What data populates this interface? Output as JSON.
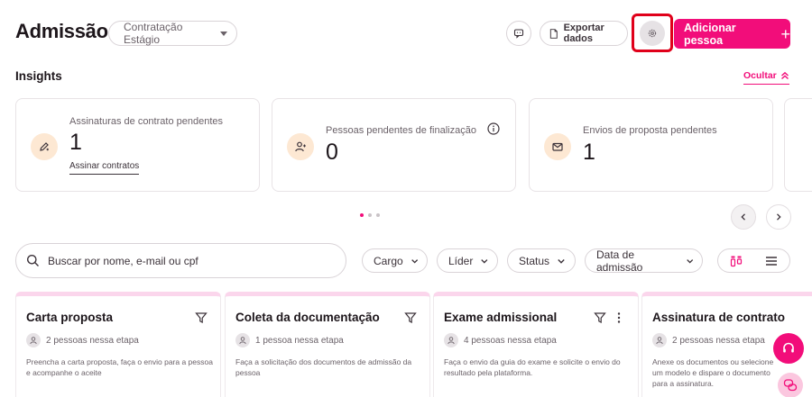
{
  "header": {
    "title": "Admissão",
    "process_select": "Contratação Estágio",
    "export_label": "Exportar dados",
    "add_label": "Adicionar pessoa"
  },
  "insights": {
    "title": "Insights",
    "hide_label": "Ocultar",
    "cards": [
      {
        "label": "Assinaturas de contrato pendentes",
        "value": "1",
        "link": "Assinar contratos"
      },
      {
        "label": "Pessoas pendentes de finalização",
        "value": "0"
      },
      {
        "label": "Envios de proposta pendentes",
        "value": "1"
      }
    ]
  },
  "filters": {
    "search_placeholder": "Buscar por nome, e-mail ou cpf",
    "cargo": "Cargo",
    "lider": "Líder",
    "status": "Status",
    "data_admissao": "Data de admissão"
  },
  "columns": [
    {
      "title": "Carta proposta",
      "count": "2 pessoas nessa etapa",
      "desc": "Preencha a carta proposta, faça o envio para a pessoa e acompanhe o aceite"
    },
    {
      "title": "Coleta da documentação",
      "count": "1 pessoa nessa etapa",
      "desc": "Faça a solicitação dos documentos de admissão da pessoa"
    },
    {
      "title": "Exame admissional",
      "count": "4 pessoas nessa etapa",
      "desc": "Faça o envio da guia do exame e solicite o envio do resultado pela plataforma."
    },
    {
      "title": "Assinatura de contrato",
      "count": "2 pessoas nessa etapa",
      "desc": "Anexe os documentos ou selecione um modelo e dispare o documento para a assinatura."
    }
  ],
  "colors": {
    "accent": "#f20d7a",
    "highlight": "#e0001a",
    "icon_bg": "#fde8d3"
  }
}
